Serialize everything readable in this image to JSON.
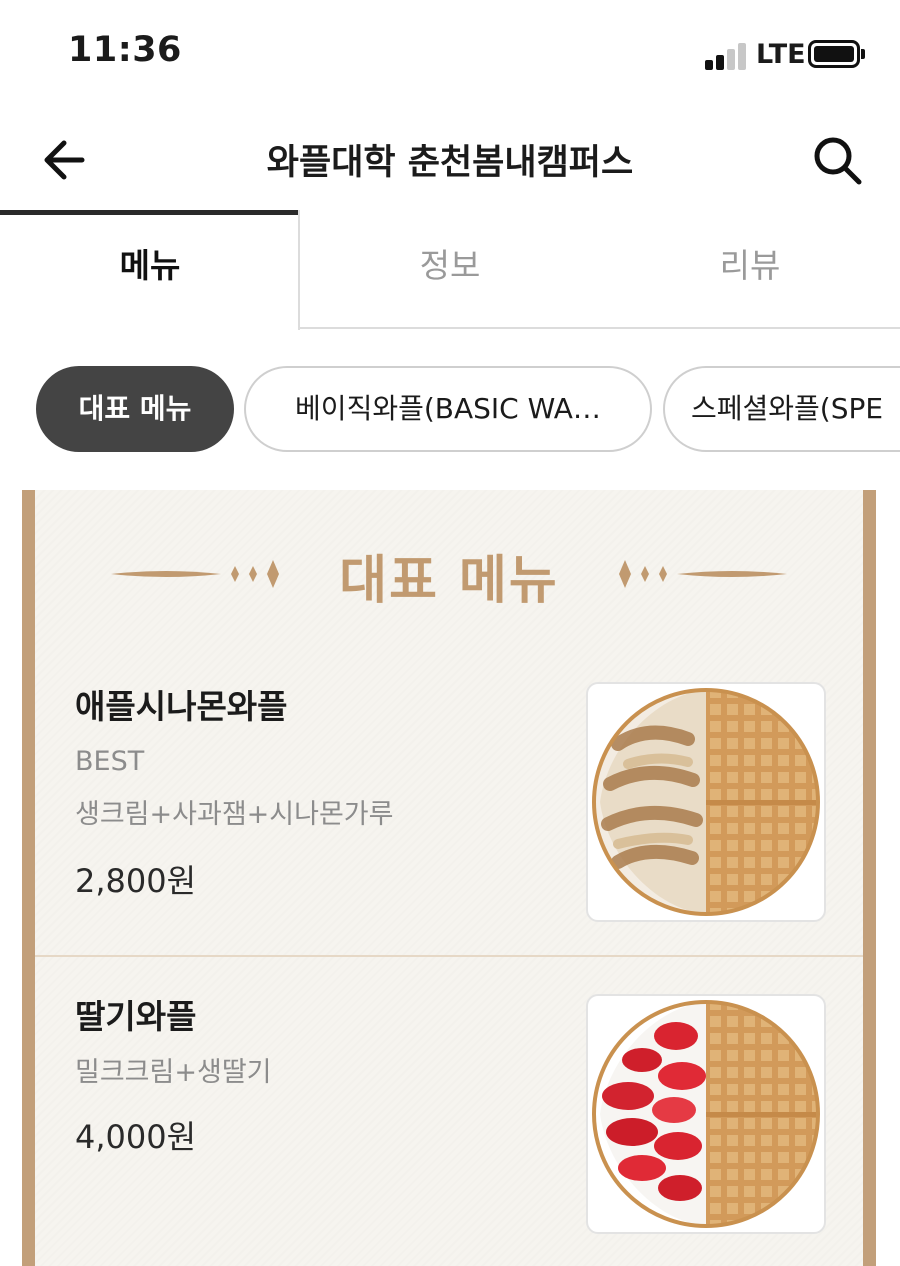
{
  "status": {
    "time": "11:36",
    "network": "LTE"
  },
  "header": {
    "title": "와플대학 춘천봄내캠퍼스",
    "back_icon": "arrow-left-icon",
    "search_icon": "search-icon"
  },
  "tabs": [
    {
      "label": "메뉴",
      "active": true
    },
    {
      "label": "정보",
      "active": false
    },
    {
      "label": "리뷰",
      "active": false
    }
  ],
  "categories": [
    {
      "label": "대표 메뉴",
      "active": true
    },
    {
      "label": "베이직와플(BASIC WA…",
      "active": false
    },
    {
      "label": "스페셜와플(SPE",
      "active": false
    }
  ],
  "section": {
    "title": "대표 메뉴"
  },
  "menu_items": [
    {
      "name": "애플시나몬와플",
      "badge": "BEST",
      "description": "생크림+사과잼+시나몬가루",
      "price": "2,800원",
      "image": "apple-cinnamon-waffle-photo"
    },
    {
      "name": "딸기와플",
      "description": "밀크크림+생딸기",
      "price": "4,000원",
      "image": "strawberry-waffle-photo"
    }
  ],
  "colors": {
    "accent_gold": "#c19a70",
    "frame_gold": "#c29f7a",
    "chip_active": "#444444",
    "card_bg": "#f6f4ef"
  }
}
